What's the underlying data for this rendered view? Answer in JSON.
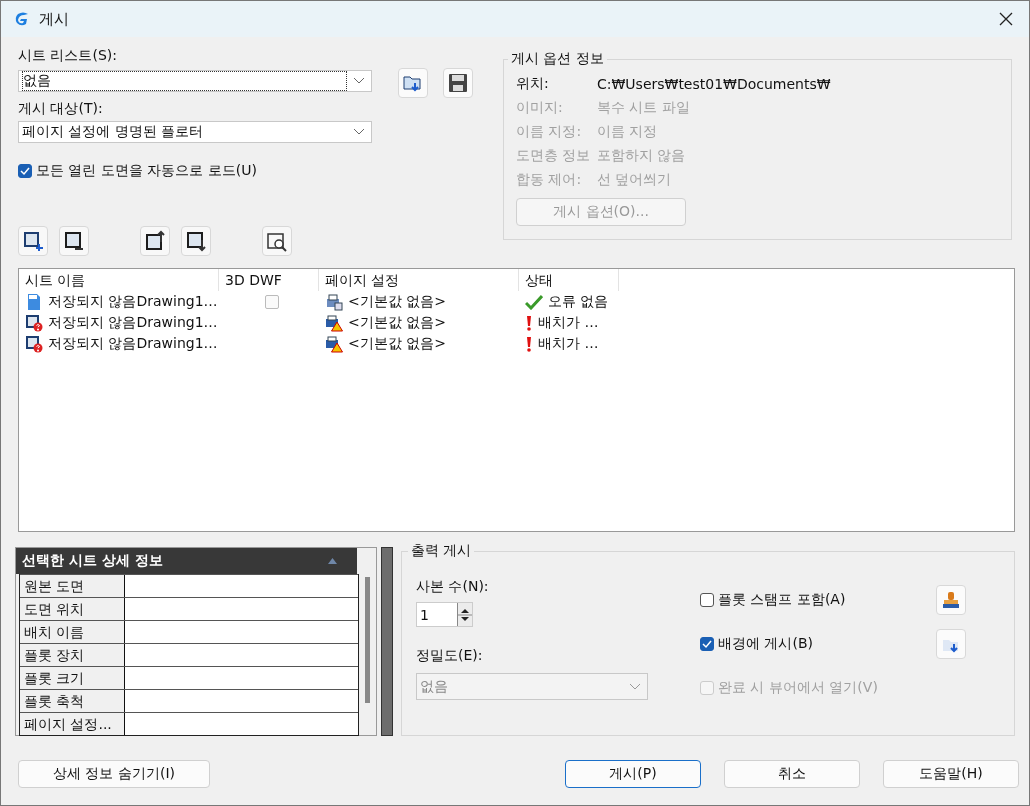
{
  "window": {
    "title": "게시"
  },
  "sheet_list": {
    "label": "시트 리스트(S):",
    "value": "없음"
  },
  "publish_to": {
    "label": "게시 대상(T):",
    "value": "페이지 설정에 명명된 플로터"
  },
  "auto_load": {
    "label": "모든 열린 도면을 자동으로 로드(U)",
    "checked": true
  },
  "options_info": {
    "title": "게시 옵션 정보",
    "rows": [
      {
        "label": "위치:",
        "value": "C:₩Users₩test01₩Documents₩",
        "disabled": false
      },
      {
        "label": "이미지:",
        "value": "복수 시트 파일",
        "disabled": true
      },
      {
        "label": "이름 지정:",
        "value": "이름 지정",
        "disabled": true
      },
      {
        "label": "도면층 정보",
        "value": "포함하지 않음",
        "disabled": true
      },
      {
        "label": "합동 제어:",
        "value": "선 덮어씌기",
        "disabled": true
      }
    ],
    "button": {
      "label": "게시 옵션(O)...",
      "disabled": true
    }
  },
  "sheets": {
    "columns": [
      "시트 이름",
      "3D DWF",
      "페이지 설정",
      "상태"
    ],
    "rows": [
      {
        "kind": "dwf",
        "name": "저장되지 않음Drawing1…",
        "dwf_3d": false,
        "page_setup": "<기본값 없음>",
        "status": {
          "kind": "ok",
          "text": "오류 없음"
        }
      },
      {
        "kind": "layout",
        "name": "저장되지 않음Drawing1…",
        "page_setup": "<기본값 없음>",
        "status": {
          "kind": "warning",
          "text": "배치가 …"
        }
      },
      {
        "kind": "layout",
        "name": "저장되지 않음Drawing1…",
        "page_setup": "<기본값 없음>",
        "status": {
          "kind": "warning",
          "text": "배치가 …"
        }
      }
    ]
  },
  "details": {
    "title": "선택한 시트 상세 정보",
    "rows": [
      "원본 도면",
      "도면 위치",
      "배치 이름",
      "플롯 장치",
      "플롯 크기",
      "플롯 축척",
      "페이지 설정..."
    ]
  },
  "output": {
    "title": "출력 게시",
    "copies_label": "사본 수(N):",
    "copies": "1",
    "precision_label": "정밀도(E):",
    "precision": "없음",
    "precision_disabled": true,
    "options": [
      {
        "kind": "stamp",
        "label": "플롯 스탬프 포함(A)",
        "checked": false,
        "disabled": false
      },
      {
        "kind": "publish",
        "label": "배경에 게시(B)",
        "checked": true,
        "disabled": false
      },
      {
        "kind": "plain",
        "label": "완료 시 뷰어에서 열기(V)",
        "checked": false,
        "disabled": true
      }
    ]
  },
  "buttons": [
    {
      "label": "상세 정보 숨기기(I)",
      "default": false
    },
    {
      "label": "게시(P)",
      "default": true
    },
    {
      "label": "취소",
      "default": false
    },
    {
      "label": "도움말(H)",
      "default": false
    }
  ]
}
